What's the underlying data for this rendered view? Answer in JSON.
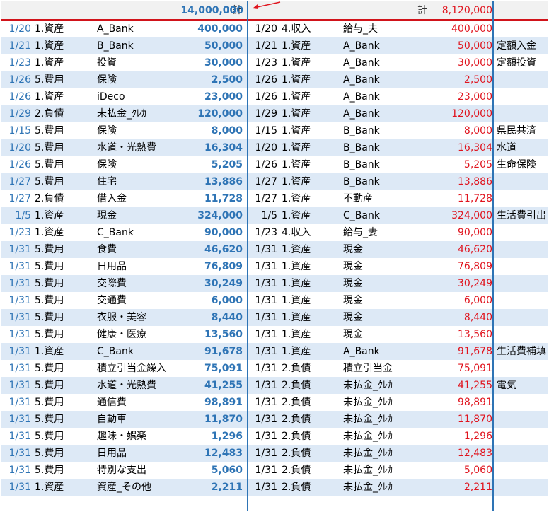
{
  "header": {
    "left_label": "計",
    "left_total": "14,000,000",
    "right_label": "計",
    "right_total": "8,120,000"
  },
  "colors": {
    "debit_blue": "#2e74b5",
    "credit_red": "#e0141e",
    "band": "#dde9f6",
    "header_line": "#d1131a"
  },
  "rows": [
    {
      "dl": "1/20",
      "al": "1.資産",
      "sl": "A_Bank",
      "vl": "400,000",
      "dr": "1/20",
      "ar": "4.収入",
      "sr": "給与_夫",
      "vr": "400,000",
      "note": ""
    },
    {
      "dl": "1/21",
      "al": "1.資産",
      "sl": "B_Bank",
      "vl": "50,000",
      "dr": "1/21",
      "ar": "1.資産",
      "sr": "A_Bank",
      "vr": "50,000",
      "note": "定額入金"
    },
    {
      "dl": "1/23",
      "al": "1.資産",
      "sl": "投資",
      "vl": "30,000",
      "dr": "1/23",
      "ar": "1.資産",
      "sr": "A_Bank",
      "vr": "30,000",
      "note": "定額投資"
    },
    {
      "dl": "1/26",
      "al": "5.費用",
      "sl": "保険",
      "vl": "2,500",
      "dr": "1/26",
      "ar": "1.資産",
      "sr": "A_Bank",
      "vr": "2,500",
      "note": ""
    },
    {
      "dl": "1/26",
      "al": "1.資産",
      "sl": "iDeco",
      "vl": "23,000",
      "dr": "1/26",
      "ar": "1.資産",
      "sr": "A_Bank",
      "vr": "23,000",
      "note": ""
    },
    {
      "dl": "1/29",
      "al": "2.負債",
      "sl": "未払金_ｸﾚｶ",
      "vl": "120,000",
      "dr": "1/29",
      "ar": "1.資産",
      "sr": "A_Bank",
      "vr": "120,000",
      "note": ""
    },
    {
      "dl": "1/15",
      "al": "5.費用",
      "sl": "保険",
      "vl": "8,000",
      "dr": "1/15",
      "ar": "1.資産",
      "sr": "B_Bank",
      "vr": "8,000",
      "note": "県民共済"
    },
    {
      "dl": "1/20",
      "al": "5.費用",
      "sl": "水道・光熱費",
      "vl": "16,304",
      "dr": "1/20",
      "ar": "1.資産",
      "sr": "B_Bank",
      "vr": "16,304",
      "note": "水道"
    },
    {
      "dl": "1/26",
      "al": "5.費用",
      "sl": "保険",
      "vl": "5,205",
      "dr": "1/26",
      "ar": "1.資産",
      "sr": "B_Bank",
      "vr": "5,205",
      "note": "生命保険"
    },
    {
      "dl": "1/27",
      "al": "5.費用",
      "sl": "住宅",
      "vl": "13,886",
      "dr": "1/27",
      "ar": "1.資産",
      "sr": "B_Bank",
      "vr": "13,886",
      "note": ""
    },
    {
      "dl": "1/27",
      "al": "2.負債",
      "sl": "借入金",
      "vl": "11,728",
      "dr": "1/27",
      "ar": "1.資産",
      "sr": "不動産",
      "vr": "11,728",
      "note": ""
    },
    {
      "dl": "1/5",
      "al": "1.資産",
      "sl": "現金",
      "vl": "324,000",
      "dr": "1/5",
      "ar": "1.資産",
      "sr": "C_Bank",
      "vr": "324,000",
      "note": "生活費引出"
    },
    {
      "dl": "1/23",
      "al": "1.資産",
      "sl": "C_Bank",
      "vl": "90,000",
      "dr": "1/23",
      "ar": "4.収入",
      "sr": "給与_妻",
      "vr": "90,000",
      "note": ""
    },
    {
      "dl": "1/31",
      "al": "5.費用",
      "sl": "食費",
      "vl": "46,620",
      "dr": "1/31",
      "ar": "1.資産",
      "sr": "現金",
      "vr": "46,620",
      "note": ""
    },
    {
      "dl": "1/31",
      "al": "5.費用",
      "sl": "日用品",
      "vl": "76,809",
      "dr": "1/31",
      "ar": "1.資産",
      "sr": "現金",
      "vr": "76,809",
      "note": ""
    },
    {
      "dl": "1/31",
      "al": "5.費用",
      "sl": "交際費",
      "vl": "30,249",
      "dr": "1/31",
      "ar": "1.資産",
      "sr": "現金",
      "vr": "30,249",
      "note": ""
    },
    {
      "dl": "1/31",
      "al": "5.費用",
      "sl": "交通費",
      "vl": "6,000",
      "dr": "1/31",
      "ar": "1.資産",
      "sr": "現金",
      "vr": "6,000",
      "note": ""
    },
    {
      "dl": "1/31",
      "al": "5.費用",
      "sl": "衣服・美容",
      "vl": "8,440",
      "dr": "1/31",
      "ar": "1.資産",
      "sr": "現金",
      "vr": "8,440",
      "note": ""
    },
    {
      "dl": "1/31",
      "al": "5.費用",
      "sl": "健康・医療",
      "vl": "13,560",
      "dr": "1/31",
      "ar": "1.資産",
      "sr": "現金",
      "vr": "13,560",
      "note": ""
    },
    {
      "dl": "1/31",
      "al": "1.資産",
      "sl": "C_Bank",
      "vl": "91,678",
      "dr": "1/31",
      "ar": "1.資産",
      "sr": "A_Bank",
      "vr": "91,678",
      "note": "生活費補填"
    },
    {
      "dl": "1/31",
      "al": "5.費用",
      "sl": "積立引当金繰入",
      "vl": "75,091",
      "dr": "1/31",
      "ar": "2.負債",
      "sr": "積立引当金",
      "vr": "75,091",
      "note": ""
    },
    {
      "dl": "1/31",
      "al": "5.費用",
      "sl": "水道・光熱費",
      "vl": "41,255",
      "dr": "1/31",
      "ar": "2.負債",
      "sr": "未払金_ｸﾚｶ",
      "vr": "41,255",
      "note": "電気"
    },
    {
      "dl": "1/31",
      "al": "5.費用",
      "sl": "通信費",
      "vl": "98,891",
      "dr": "1/31",
      "ar": "2.負債",
      "sr": "未払金_ｸﾚｶ",
      "vr": "98,891",
      "note": ""
    },
    {
      "dl": "1/31",
      "al": "5.費用",
      "sl": "自動車",
      "vl": "11,870",
      "dr": "1/31",
      "ar": "2.負債",
      "sr": "未払金_ｸﾚｶ",
      "vr": "11,870",
      "note": ""
    },
    {
      "dl": "1/31",
      "al": "5.費用",
      "sl": "趣味・娯楽",
      "vl": "1,296",
      "dr": "1/31",
      "ar": "2.負債",
      "sr": "未払金_ｸﾚｶ",
      "vr": "1,296",
      "note": ""
    },
    {
      "dl": "1/31",
      "al": "5.費用",
      "sl": "日用品",
      "vl": "12,483",
      "dr": "1/31",
      "ar": "2.負債",
      "sr": "未払金_ｸﾚｶ",
      "vr": "12,483",
      "note": ""
    },
    {
      "dl": "1/31",
      "al": "5.費用",
      "sl": "特別な支出",
      "vl": "5,060",
      "dr": "1/31",
      "ar": "2.負債",
      "sr": "未払金_ｸﾚｶ",
      "vr": "5,060",
      "note": ""
    },
    {
      "dl": "1/31",
      "al": "1.資産",
      "sl": "資産_その他",
      "vl": "2,211",
      "dr": "1/31",
      "ar": "2.負債",
      "sr": "未払金_ｸﾚｶ",
      "vr": "2,211",
      "note": ""
    }
  ]
}
